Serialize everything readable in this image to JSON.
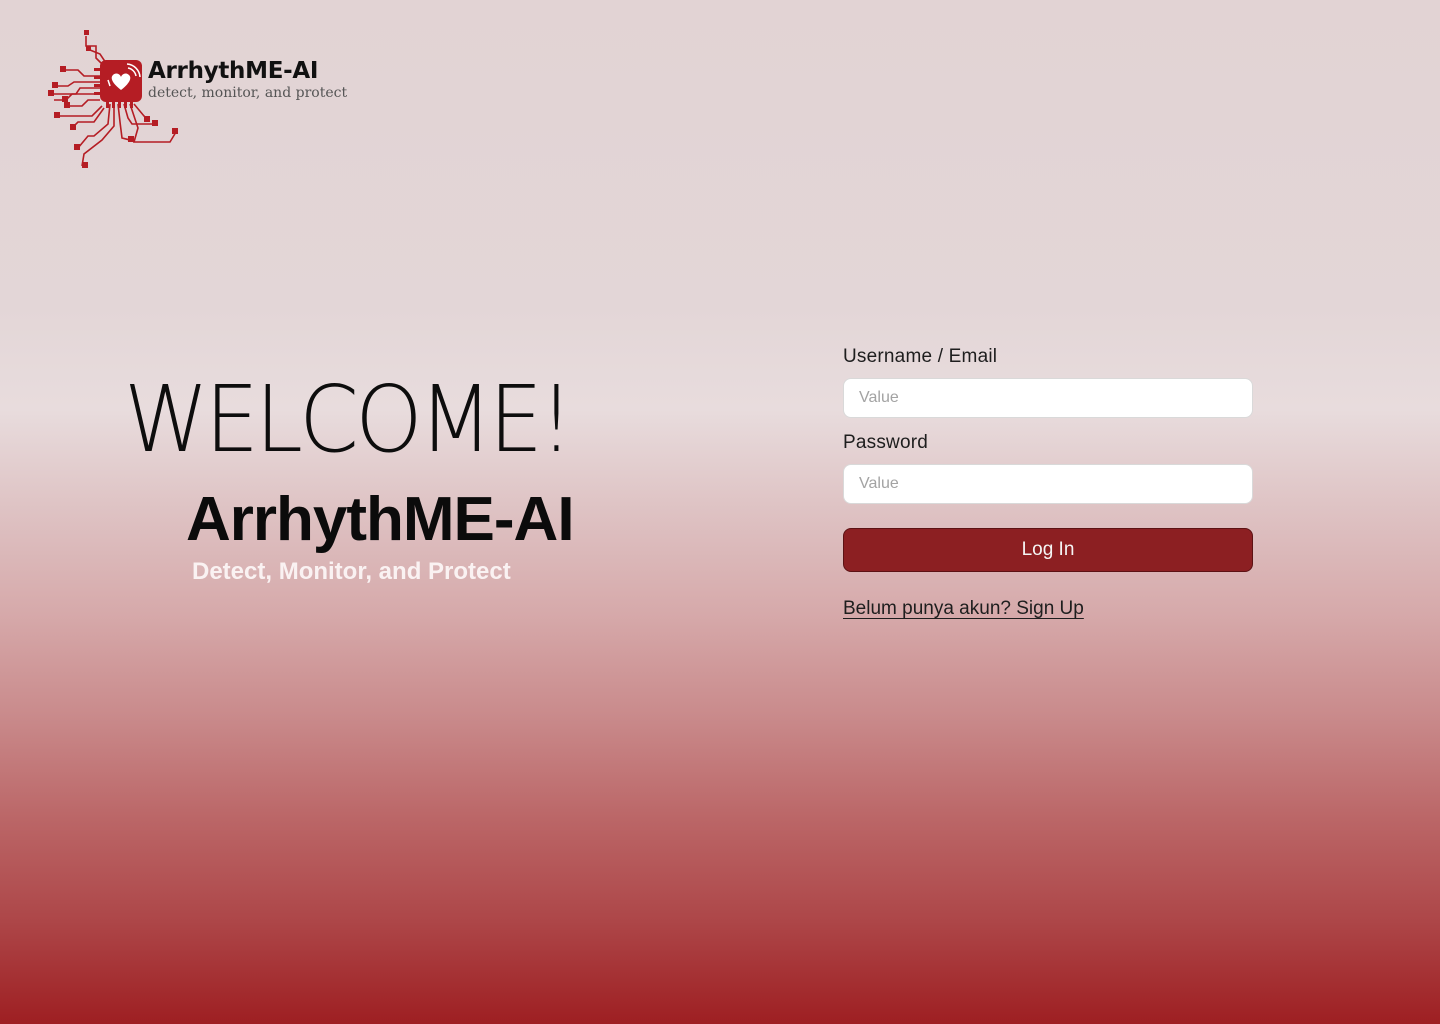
{
  "logo": {
    "title": "ArrhythME-AI",
    "tagline": "detect, monitor, and protect",
    "icon": "circuit-heart-chip-icon",
    "color": "#b51d24"
  },
  "hero": {
    "welcome": "WELCOME!",
    "brand": "ArrhythME-AI",
    "tagline": "Detect, Monitor, and Protect"
  },
  "form": {
    "username_label": "Username / Email",
    "username_placeholder": "Value",
    "username_value": "",
    "password_label": "Password",
    "password_placeholder": "Value",
    "password_value": "",
    "login_label": "Log In",
    "signup_text": "Belum punya akun? Sign Up"
  },
  "colors": {
    "accent": "#8c1f22",
    "background_top": "#e2d3d4",
    "background_bottom": "#9e1f22"
  }
}
